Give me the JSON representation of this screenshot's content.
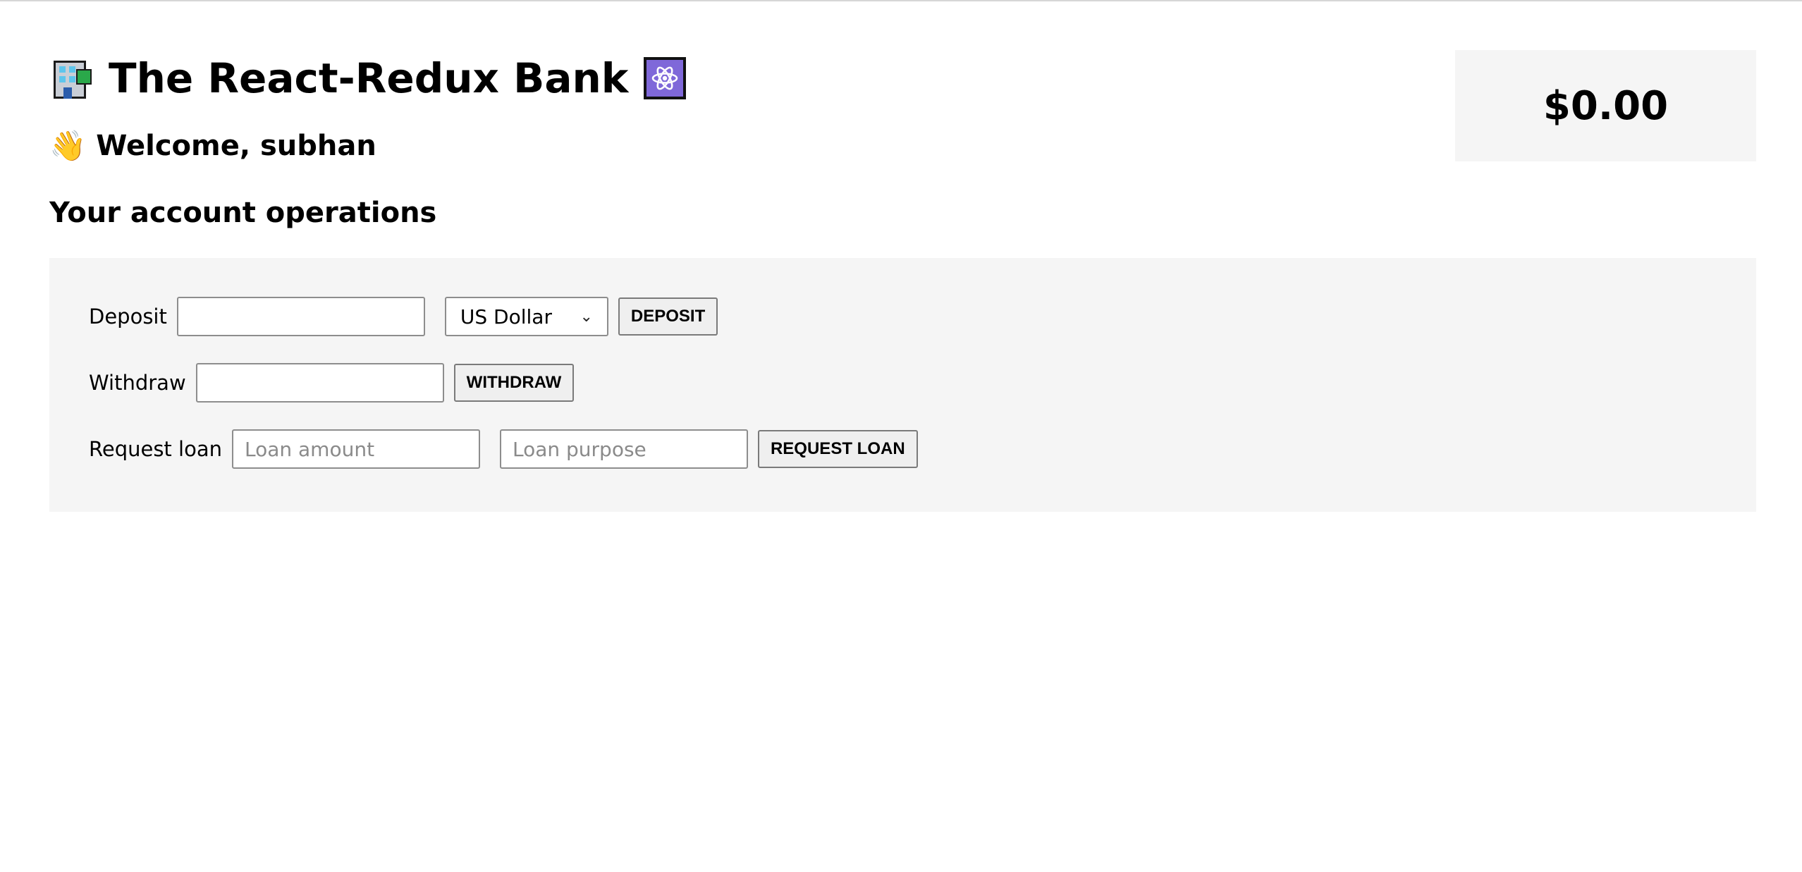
{
  "header": {
    "title": "The React-Redux Bank",
    "left_icon": "building-icon",
    "right_icon": "atom-icon"
  },
  "welcome": {
    "icon": "waving-hand-icon",
    "emoji": "👋",
    "text": "Welcome, subhan"
  },
  "operations": {
    "title": "Your account operations",
    "deposit": {
      "label": "Deposit",
      "value": "",
      "currency": "US Dollar",
      "button": "DEPOSIT"
    },
    "withdraw": {
      "label": "Withdraw",
      "value": "",
      "button": "WITHDRAW"
    },
    "loan": {
      "label": "Request loan",
      "amount_placeholder": "Loan amount",
      "purpose_placeholder": "Loan purpose",
      "button": "REQUEST LOAN"
    }
  },
  "balance": {
    "amount": "$0.00"
  },
  "colors": {
    "panel_bg": "#f5f5f5",
    "atom_bg": "#7f68d9"
  }
}
